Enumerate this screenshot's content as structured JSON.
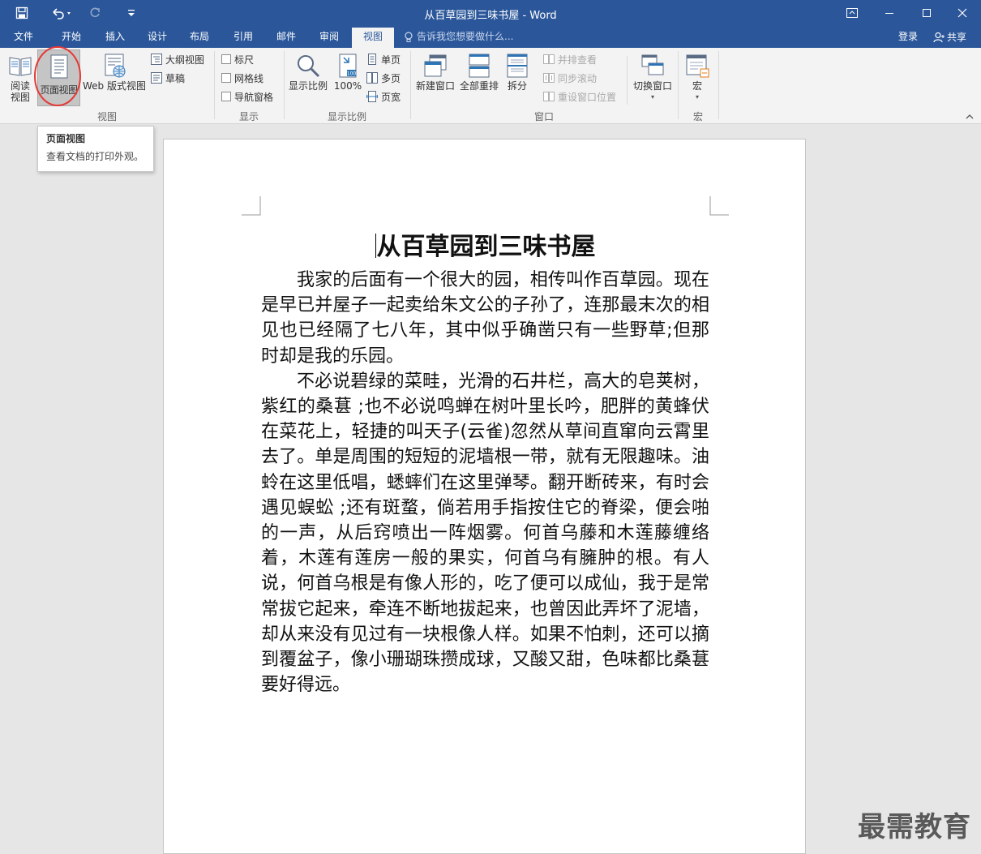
{
  "window": {
    "title": "从百草园到三味书屋 - Word"
  },
  "tabs": [
    {
      "label": "文件",
      "active": false
    },
    {
      "label": "开始",
      "active": false
    },
    {
      "label": "插入",
      "active": false
    },
    {
      "label": "设计",
      "active": false
    },
    {
      "label": "布局",
      "active": false
    },
    {
      "label": "引用",
      "active": false
    },
    {
      "label": "邮件",
      "active": false
    },
    {
      "label": "审阅",
      "active": false
    },
    {
      "label": "视图",
      "active": true
    }
  ],
  "tell_me": "告诉我您想要做什么...",
  "account": {
    "login": "登录",
    "share": "共享"
  },
  "ribbon": {
    "views": {
      "read": "阅读\n视图",
      "print_layout": "页面视图",
      "web_layout": "Web 版式视图",
      "outline": "大纲视图",
      "draft": "草稿",
      "group_label": "视图"
    },
    "show": {
      "ruler": "标尺",
      "gridlines": "网格线",
      "nav_pane": "导航窗格",
      "group_label": "显示"
    },
    "zoom": {
      "zoom": "显示比例",
      "hundred": "100%",
      "one_page": "单页",
      "multiple_pages": "多页",
      "page_width": "页宽",
      "group_label": "显示比例"
    },
    "window": {
      "new_window": "新建窗口",
      "arrange_all": "全部重排",
      "split": "拆分",
      "side_by_side": "并排查看",
      "sync_scroll": "同步滚动",
      "reset_position": "重设窗口位置",
      "switch_windows": "切换窗口",
      "group_label": "窗口"
    },
    "macros": {
      "macros": "宏",
      "group_label": "宏"
    }
  },
  "tooltip": {
    "title": "页面视图",
    "description": "查看文档的打印外观。"
  },
  "document": {
    "title": "从百草园到三味书屋",
    "paragraphs": [
      "我家的后面有一个很大的园，相传叫作百草园。现在是早已并屋子一起卖给朱文公的子孙了，连那最末次的相见也已经隔了七八年，其中似乎确凿只有一些野草;但那时却是我的乐园。",
      "不必说碧绿的菜畦，光滑的石井栏，高大的皂荚树，紫红的桑葚 ;也不必说鸣蝉在树叶里长吟，肥胖的黄蜂伏在菜花上，轻捷的叫天子(云雀)忽然从草间直窜向云霄里去了。单是周围的短短的泥墙根一带，就有无限趣味。油蛉在这里低唱，蟋蟀们在这里弹琴。翻开断砖来，有时会遇见蜈蚣 ;还有斑蝥，倘若用手指按住它的脊梁，便会啪的一声，从后窍喷出一阵烟雾。何首乌藤和木莲藤缠络着，木莲有莲房一般的果实，何首乌有臃肿的根。有人说，何首乌根是有像人形的，吃了便可以成仙，我于是常常拔它起来，牵连不断地拔起来，也曾因此弄坏了泥墙，却从来没有见过有一块根像人样。如果不怕刺，还可以摘到覆盆子，像小珊瑚珠攒成球，又酸又甜，色味都比桑葚要好得远。"
    ]
  },
  "watermark": "最需教育",
  "colors": {
    "accent": "#2b579a",
    "annotation_circle": "#e53935"
  }
}
